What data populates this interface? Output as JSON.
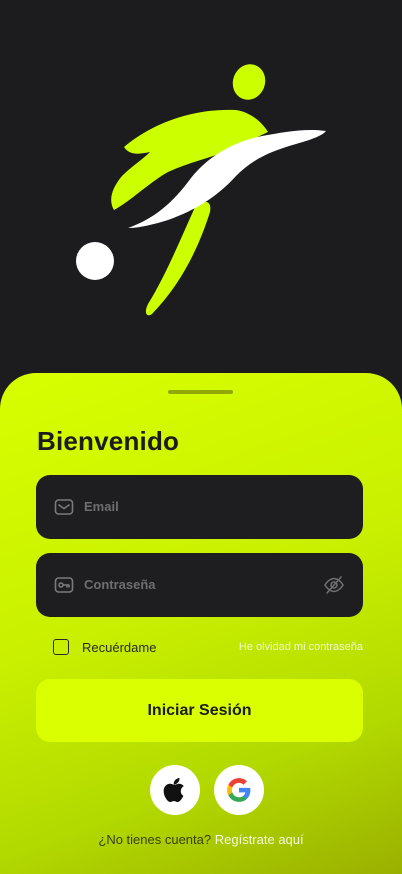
{
  "hero": {
    "icon": "soccer-player-logo"
  },
  "login": {
    "title": "Bienvenido",
    "email_placeholder": "Email",
    "password_placeholder": "Contraseña",
    "remember_label": "Recuérdame",
    "forgot_link": "He olvidad mi contraseña",
    "submit_label": "Iniciar Sesión",
    "social": [
      "apple",
      "google"
    ],
    "signup_question": "¿No tienes cuenta?",
    "signup_link": "Regístrate aquí"
  },
  "colors": {
    "background": "#1c1c1e",
    "accent": "#d9ff00",
    "field": "#1e1e20"
  }
}
